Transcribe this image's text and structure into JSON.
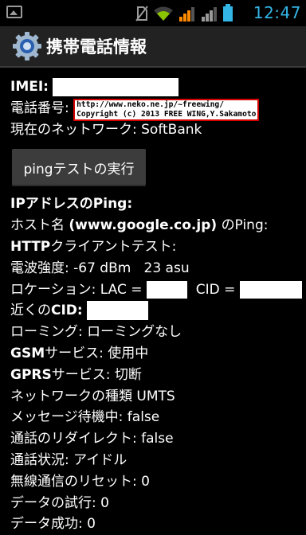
{
  "status_bar": {
    "time": "12:47",
    "icons": [
      "image-notification-icon",
      "no-sim-icon",
      "wifi-icon",
      "signal-bars-icon",
      "signal-bars-icon",
      "battery-icon"
    ]
  },
  "action_bar": {
    "title": "携帯電話情報"
  },
  "info": {
    "imei_label": "IMEI:",
    "phone_label": "電話番号:",
    "copyright_line1": "http://www.neko.ne.jp/~freewing/",
    "copyright_line2": "Copyright (c) 2013 FREE WING,Y.Sakamoto",
    "network_label": "現在のネットワーク: SoftBank",
    "ping_button": "pingテストの実行",
    "ip_ping": "IPアドレスのPing:",
    "host_prefix": "ホスト名",
    "host_bold": "(www.google.co.jp)",
    "host_suffix": "のPing:",
    "http_test_bold": "HTTP",
    "http_test_rest": "クライアントテスト:",
    "signal": "電波強度: -67 dBm   23 asu",
    "location_lac": "ロケーション: LAC =",
    "location_cid": "CID =",
    "nearby_prefix": "近くの",
    "nearby_bold": "CID:",
    "roaming": "ローミング: ローミングなし",
    "gsm_bold": "GSM",
    "gsm_rest": "サービス: 使用中",
    "gprs_bold": "GPRS",
    "gprs_rest": "サービス: 切断",
    "network_type": "ネットワークの種類 UMTS",
    "message_waiting": "メッセージ待機中: false",
    "call_redirect": "通話のリダイレクト: false",
    "call_status": "通話状況: アイドル",
    "radio_reset": "無線通信のリセット: 0",
    "data_attempts": "データの試行: 0",
    "data_success": "データ成功: 0"
  }
}
